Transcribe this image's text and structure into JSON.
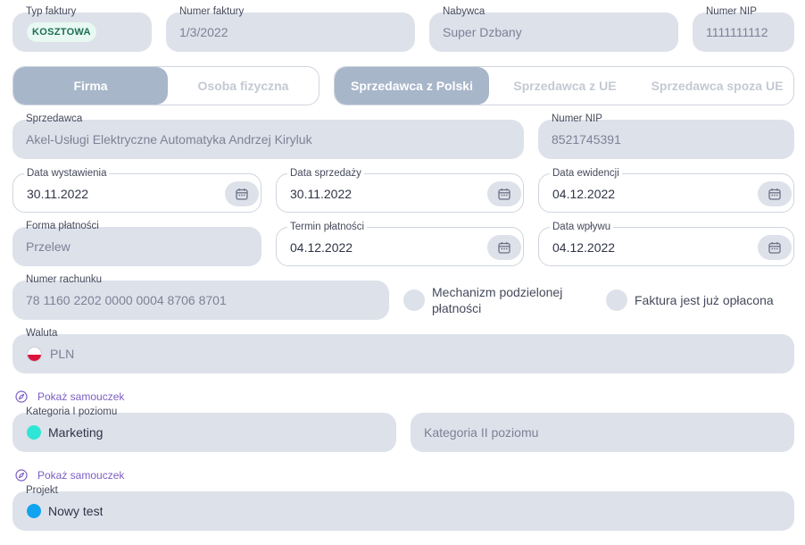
{
  "top_row": {
    "invoice_type": {
      "label": "Typ faktury",
      "badge": "KOSZTOWA"
    },
    "invoice_number": {
      "label": "Numer faktury",
      "value": "1/3/2022"
    },
    "buyer": {
      "label": "Nabywca",
      "value": "Super Dzbany"
    },
    "buyer_nip": {
      "label": "Numer NIP",
      "value": "1111111112"
    }
  },
  "entity_toggle": {
    "options": [
      "Firma",
      "Osoba fizyczna"
    ],
    "active": "Firma"
  },
  "seller_origin_toggle": {
    "options": [
      "Sprzedawca z Polski",
      "Sprzedawca z UE",
      "Sprzedawca spoza UE"
    ],
    "active": "Sprzedawca z Polski"
  },
  "seller": {
    "label": "Sprzedawca",
    "value": "Akel-Usługi Elektryczne Automatyka Andrzej Kiryluk"
  },
  "seller_nip": {
    "label": "Numer NIP",
    "value": "8521745391"
  },
  "dates": {
    "issue": {
      "label": "Data wystawienia",
      "value": "30.11.2022"
    },
    "sale": {
      "label": "Data sprzedaży",
      "value": "30.11.2022"
    },
    "record": {
      "label": "Data ewidencji",
      "value": "04.12.2022"
    }
  },
  "payment_method": {
    "label": "Forma płatności",
    "value": "Przelew"
  },
  "payment_due": {
    "label": "Termin płatności",
    "value": "04.12.2022"
  },
  "receipt_date": {
    "label": "Data wpływu",
    "value": "04.12.2022"
  },
  "account_number": {
    "label": "Numer rachunku",
    "value": "78 1160 2202 0000 0004 8706 8701"
  },
  "split_payment": {
    "label_line1": "Mechanizm podzielonej",
    "label_line2": "płatności"
  },
  "paid": {
    "label": "Faktura jest już opłacona"
  },
  "currency": {
    "label": "Waluta",
    "value": "PLN"
  },
  "tutorial_link": {
    "label": "Pokaż samouczek"
  },
  "category1": {
    "label": "Kategoria I poziomu",
    "value": "Marketing",
    "color": "#2ee6d6"
  },
  "category2": {
    "placeholder": "Kategoria II poziomu"
  },
  "tutorial_link_2": {
    "label": "Pokaż samouczek"
  },
  "project": {
    "label": "Projekt",
    "value": "Nowy test",
    "color": "#10a4f0"
  },
  "icons": {
    "calendar": "calendar-icon",
    "compass": "compass-icon",
    "flag": "flag-pl-icon"
  },
  "colors": {
    "field_bg": "#dde1ea",
    "active_toggle": "#a7b6c9",
    "link": "#7c5ec4",
    "badge_bg": "#e8f8f2"
  }
}
